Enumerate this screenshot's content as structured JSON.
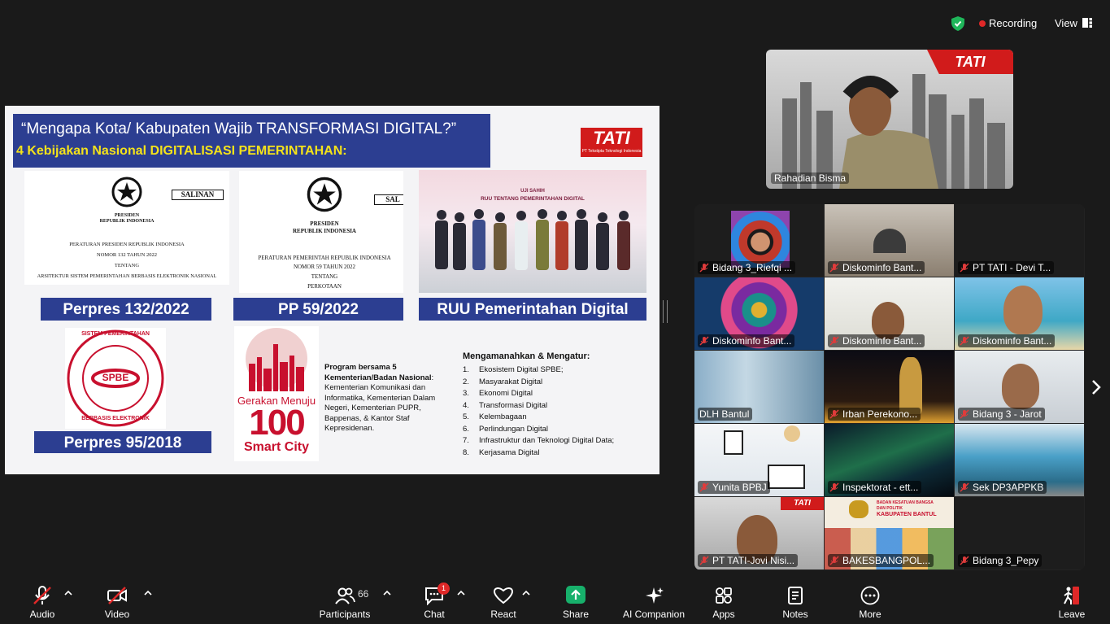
{
  "topbar": {
    "recording_label": "Recording",
    "view_label": "View"
  },
  "slide": {
    "title": "“Mengapa Kota/ Kabupaten Wajib TRANSFORMASI DIGITAL?”",
    "subtitle": "4 Kebijakan Nasional DIGITALISASI PEMERINTAHAN:",
    "logo_text": "TATI",
    "logo_caption": "PT Tekstipta Teknologi Indonesia",
    "doc1": {
      "badge": "SALINAN",
      "president": "PRESIDEN",
      "republic": "REPUBLIK INDONESIA",
      "line1": "PERATURAN PRESIDEN REPUBLIK INDONESIA",
      "line2": "NOMOR 132 TAHUN 2022",
      "line3": "TENTANG",
      "line4": "ARSITEKTUR SISTEM PEMERINTAHAN BERBASIS ELEKTRONIK NASIONAL"
    },
    "doc2": {
      "badge": "SAL",
      "president": "PRESIDEN",
      "republic": "REPUBLIK INDONESIA",
      "line1": "PERATURAN PEMERINTAH REPUBLIK INDONESIA",
      "line2": "NOMOR 59 TAHUN 2022",
      "line3": "TENTANG",
      "line4": "PERKOTAAN"
    },
    "photo_banner1": "UJI SAHIH",
    "photo_banner2": "RUU TENTANG PEMERINTAHAN DIGITAL",
    "label_perpres132": "Perpres 132/2022",
    "label_pp59": "PP 59/2022",
    "label_ruu": "RUU Pemerintahan Digital",
    "label_perpres95": "Perpres 95/2018",
    "spbe_top": "SISTEM PEMERINTAHAN",
    "spbe_bottom": "BERBASIS ELEKTRONIK",
    "spbe_center": "SPBE",
    "smartcity_line1": "Gerakan Menuju",
    "smartcity_line2": "100",
    "smartcity_line3": "Smart City",
    "program_title": "Program bersama 5 Kementerian/Badan Nasional",
    "program_body": "Kementerian Komunikasi dan Informatika, Kementerian Dalam Negeri, Kementerian PUPR, Bappenas, & Kantor Staf Kepresidenan.",
    "mandate_title": "Mengamanahkan & Mengatur:",
    "mandate_items": [
      {
        "n": "1.",
        "t": "Ekosistem Digital SPBE;"
      },
      {
        "n": "2.",
        "t": "Masyarakat Digital"
      },
      {
        "n": "3.",
        "t": "Ekonomi Digital"
      },
      {
        "n": "4.",
        "t": "Transformasi Digital"
      },
      {
        "n": "5.",
        "t": "Kelembagaan"
      },
      {
        "n": "6.",
        "t": "Perlindungan Digital"
      },
      {
        "n": "7.",
        "t": "Infrastruktur dan Teknologi Digital Data;"
      },
      {
        "n": "8.",
        "t": "Kerjasama Digital"
      }
    ]
  },
  "speaker": {
    "name": "Rahadian Bisma",
    "logo_text": "TATI"
  },
  "gallery": {
    "tiles": [
      {
        "name": "Bidang 3_Riefqi ..."
      },
      {
        "name": "Diskominfo Bant..."
      },
      {
        "name": "PT TATI - Devi T..."
      },
      {
        "name": "Diskominfo Bant..."
      },
      {
        "name": "Diskominfo Bant..."
      },
      {
        "name": "Diskominfo Bant..."
      },
      {
        "name": "DLH Bantul"
      },
      {
        "name": "Irban Perekono..."
      },
      {
        "name": "Bidang 3 - Jarot"
      },
      {
        "name": "Yunita BPBJ"
      },
      {
        "name": "Inspektorat - ett..."
      },
      {
        "name": "Sek DP3APPKB"
      },
      {
        "name": "PT TATI-Jovi Nisi..."
      },
      {
        "name": "BAKESBANGPOL..."
      },
      {
        "name": "Bidang 3_Pepy"
      }
    ],
    "bakesbangpol_sign1": "BADAN KESATUAN BANGSA",
    "bakesbangpol_sign2": "DAN POLITIK",
    "bakesbangpol_sign3": "KABUPATEN BANTUL"
  },
  "toolbar": {
    "audio": "Audio",
    "video": "Video",
    "participants": "Participants",
    "participants_count": "66",
    "chat": "Chat",
    "chat_badge": "1",
    "react": "React",
    "share": "Share",
    "ai_companion": "AI Companion",
    "apps": "Apps",
    "notes": "Notes",
    "more": "More",
    "leave": "Leave"
  },
  "colors": {
    "background": "#1a1a1a",
    "slide_blue": "#2c3e91",
    "slide_yellow": "#f5e31a",
    "tati_red": "#d11b1b",
    "recording_red": "#e02828",
    "share_green": "#17b06b",
    "shield_green": "#1fb65a"
  }
}
